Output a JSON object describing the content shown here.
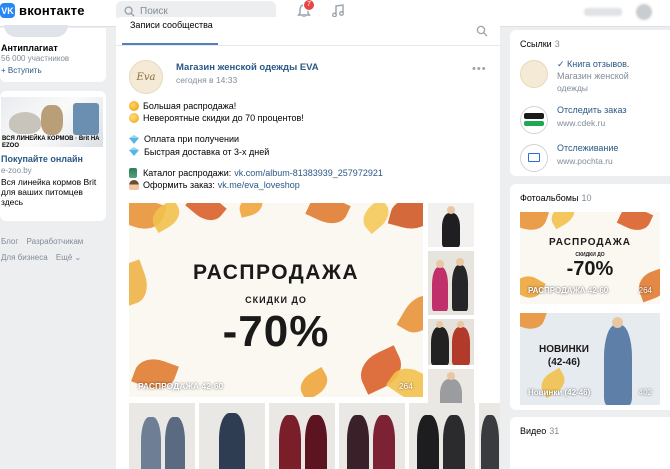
{
  "header": {
    "logo_mark": "VK",
    "logo_text": "вконтакте",
    "search_placeholder": "Поиск",
    "notifications_count": "7"
  },
  "left": {
    "group": {
      "name": "Антиплагиат",
      "members": "56 000 участников",
      "join": "+ Вступить"
    },
    "ad": {
      "image_caption": "ВСЯ ЛИНЕЙКА КОРМОВ · Brit НА EZOO",
      "title": "Покупайте онлайн",
      "domain": "e-zoo.by",
      "text": "Вся линейка кормов Brit для ваших питомцев здесь"
    },
    "footer": [
      "Блог",
      "Разработчикам",
      "Для бизнеса",
      "Ещё ⌄"
    ]
  },
  "wall": {
    "tab": "Записи сообщества",
    "post": {
      "avatar_text": "Eva",
      "author": "Магазин женской одежды EVA",
      "time": "сегодня в 14:33",
      "lines": {
        "l1": "Большая распродажа!",
        "l2": "Невероятные скидки до 70 процентов!",
        "l3": "Оплата при получении",
        "l4": "Быстрая доставка от 3-х дней",
        "l5_label": "Каталог распродажи:",
        "l5_link": "vk.com/album-81383939_257972921",
        "l6_label": "Оформить заказ:",
        "l6_link": "vk.me/eva_loveshop"
      },
      "photo": {
        "title": "РАСПРОДАЖА",
        "subtitle": "СКИДКИ ДО",
        "percent": "-70%",
        "caption": "РАСПРОДАЖА 42-60",
        "count": "264"
      }
    }
  },
  "right": {
    "links": {
      "heading": "Ссылки",
      "count": "3",
      "items": [
        {
          "title": "✓ Книга отзывов.",
          "title2": "Магазин женской",
          "sub": "одежды",
          "icon": "eva-logo-icon"
        },
        {
          "title": "Отследить заказ",
          "sub": "www.cdek.ru",
          "icon": "cdek-logo-icon"
        },
        {
          "title": "Отслеживание",
          "sub": "www.pochta.ru",
          "icon": "pochta-logo-icon"
        }
      ]
    },
    "albums": {
      "heading": "Фотоальбомы",
      "count": "10",
      "items": [
        {
          "title": "РАСПРОДАЖА",
          "subtitle": "СКИДКИ ДО",
          "percent": "-70%",
          "caption": "РАСПРОДАЖА 42-60",
          "count": "264"
        },
        {
          "title": "НОВИНКИ",
          "subtitle": "(42-46)",
          "caption": "Новинки (42-46)",
          "count": "402"
        }
      ]
    },
    "video": {
      "heading": "Видео",
      "count": "31"
    }
  },
  "colors": {
    "vk_blue": "#2787f5",
    "link": "#2a5885",
    "muted": "#818c99",
    "page_bg": "#edeef0",
    "badge": "#e64646"
  }
}
